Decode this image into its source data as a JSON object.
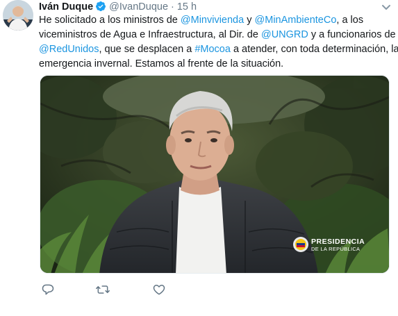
{
  "tweet": {
    "author_name": "Iván Duque",
    "handle": "@IvanDuque",
    "separator": "·",
    "time": "15 h",
    "text_segments": [
      [
        {
          "t": "He solicitado a los ministros de "
        },
        {
          "t": "@Minvivienda",
          "link": true
        },
        {
          "t": " y "
        },
        {
          "t": "@MinAmbienteCo",
          "link": true
        },
        {
          "t": ", a los"
        }
      ],
      [
        {
          "t": "viceministros de Agua e Infraestructura, al Dir. de "
        },
        {
          "t": "@UNGRD",
          "link": true
        },
        {
          "t": " y a funcionarios de"
        }
      ],
      [
        {
          "t": "@RedUnidos",
          "link": true
        },
        {
          "t": ", que se desplacen a "
        },
        {
          "t": "#Mocoa",
          "link": true
        },
        {
          "t": " a atender, con toda determinación, la"
        }
      ],
      [
        {
          "t": "emergencia invernal. Estamos al frente de la situación."
        }
      ]
    ]
  },
  "media": {
    "logo_line1": "PRESIDENCIA",
    "logo_line2": "DE LA REPÚBLICA"
  },
  "actions": [
    {
      "name": "reply-icon"
    },
    {
      "name": "retweet-icon"
    },
    {
      "name": "like-icon"
    }
  ],
  "colors": {
    "link": "#1b95e0",
    "verified": "#1da1f2",
    "muted": "#657786",
    "text": "#14171a"
  }
}
